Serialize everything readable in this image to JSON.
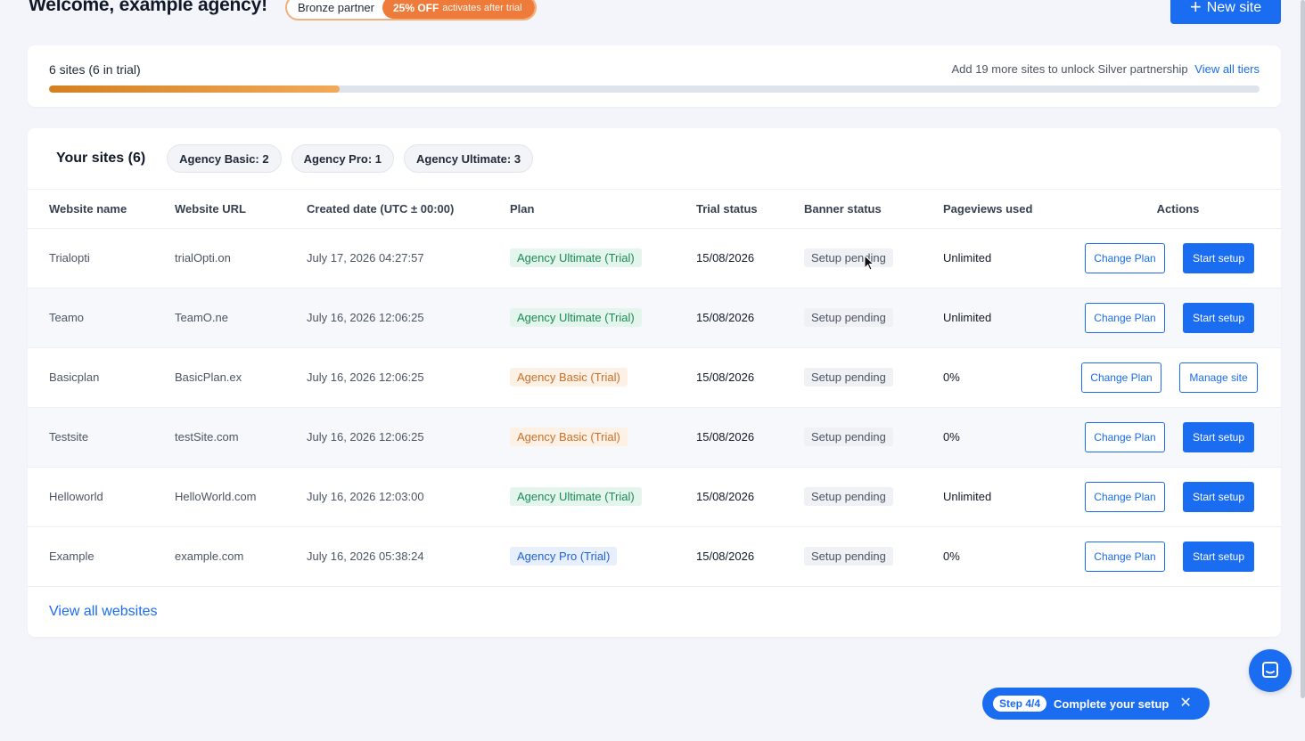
{
  "header": {
    "welcome": "Welcome, example agency!",
    "partner_tier": "Bronze partner",
    "offer_bold": "25% OFF",
    "offer_note": "activates after trial",
    "new_site_label": "New site"
  },
  "progress": {
    "sites_summary": "6 sites (6 in trial)",
    "unlock_text": "Add 19 more sites to unlock Silver partnership",
    "view_tiers_link": "View all tiers",
    "fill_fraction": 0.24
  },
  "sites": {
    "title": "Your sites (6)",
    "chips": [
      "Agency Basic: 2",
      "Agency Pro: 1",
      "Agency Ultimate: 3"
    ],
    "columns": [
      "Website name",
      "Website URL",
      "Created date (UTC ± 00:00)",
      "Plan",
      "Trial status",
      "Banner status",
      "Pageviews used",
      "Actions"
    ],
    "rows": [
      {
        "name": "Trialopti",
        "url": "trialOpti.on",
        "created": "July 17, 2026 04:27:57",
        "plan": "Agency Ultimate (Trial)",
        "trial": "15/08/2026",
        "banner": "Setup pending",
        "pageviews": "Unlimited",
        "change": "Change Plan",
        "action": "Start setup"
      },
      {
        "name": "Teamo",
        "url": "TeamO.ne",
        "created": "July 16, 2026 12:06:25",
        "plan": "Agency Ultimate (Trial)",
        "trial": "15/08/2026",
        "banner": "Setup pending",
        "pageviews": "Unlimited",
        "change": "Change Plan",
        "action": "Start setup"
      },
      {
        "name": "Basicplan",
        "url": "BasicPlan.ex",
        "created": "July 16, 2026 12:06:25",
        "plan": "Agency Basic (Trial)",
        "trial": "15/08/2026",
        "banner": "Setup pending",
        "pageviews": "0%",
        "change": "Change Plan",
        "action": "Manage site"
      },
      {
        "name": "Testsite",
        "url": "testSite.com",
        "created": "July 16, 2026 12:06:25",
        "plan": "Agency Basic (Trial)",
        "trial": "15/08/2026",
        "banner": "Setup pending",
        "pageviews": "0%",
        "change": "Change Plan",
        "action": "Start setup"
      },
      {
        "name": "Helloworld",
        "url": "HelloWorld.com",
        "created": "July 16, 2026 12:03:00",
        "plan": "Agency Ultimate (Trial)",
        "trial": "15/08/2026",
        "banner": "Setup pending",
        "pageviews": "Unlimited",
        "change": "Change Plan",
        "action": "Start setup"
      },
      {
        "name": "Example",
        "url": "example.com",
        "created": "July 16, 2026 05:38:24",
        "plan": "Agency Pro (Trial)",
        "trial": "15/08/2026",
        "banner": "Setup pending",
        "pageviews": "0%",
        "change": "Change Plan",
        "action": "Start setup"
      }
    ],
    "view_all": "View all websites"
  },
  "setup_pill": {
    "step": "Step 4/4",
    "label": "Complete your setup"
  },
  "icons": {
    "new_site": "plus-icon",
    "close": "close-icon",
    "chat": "chat-icon"
  },
  "colors": {
    "primary": "#1a6cf0",
    "offer": "#ee7b3a",
    "progress_fill": "#d4801f",
    "plan_ultimate": "#1c8a55",
    "plan_basic": "#c8702a",
    "plan_pro": "#2261d4"
  }
}
